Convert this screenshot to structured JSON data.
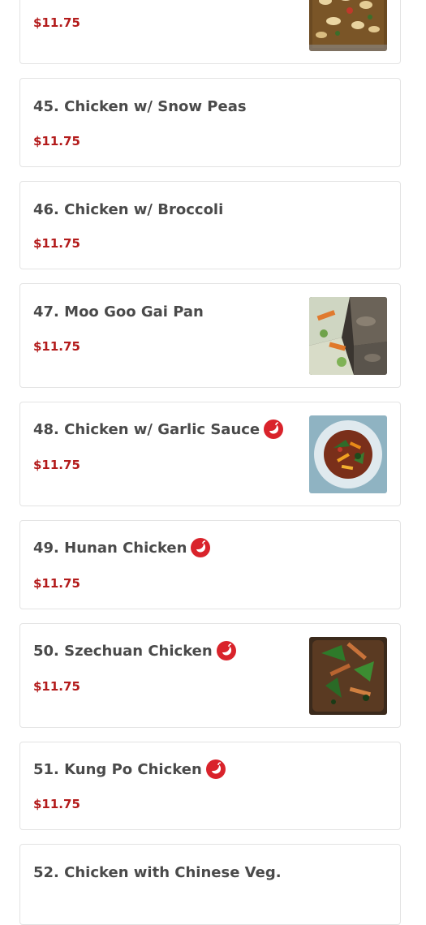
{
  "items": [
    {
      "name": "",
      "price": "$11.75",
      "has_image": true,
      "spicy": false
    },
    {
      "name": "45. Chicken w/ Snow Peas",
      "price": "$11.75",
      "has_image": false,
      "spicy": false
    },
    {
      "name": "46. Chicken w/ Broccoli",
      "price": "$11.75",
      "has_image": false,
      "spicy": false
    },
    {
      "name": "47. Moo Goo Gai Pan",
      "price": "$11.75",
      "has_image": true,
      "spicy": false
    },
    {
      "name": "48. Chicken w/ Garlic Sauce",
      "price": "$11.75",
      "has_image": true,
      "spicy": true
    },
    {
      "name": "49. Hunan Chicken",
      "price": "$11.75",
      "has_image": false,
      "spicy": true
    },
    {
      "name": "50. Szechuan Chicken",
      "price": "$11.75",
      "has_image": true,
      "spicy": true
    },
    {
      "name": "51. Kung Po Chicken",
      "price": "$11.75",
      "has_image": false,
      "spicy": true
    },
    {
      "name": "52. Chicken with Chinese Veg.",
      "price": "",
      "has_image": false,
      "spicy": false
    }
  ],
  "icons": {
    "spicy": "chili-pepper-icon"
  },
  "colors": {
    "price": "#b31b1b",
    "spicy": "#d9232b",
    "title": "#4a4a4a"
  }
}
